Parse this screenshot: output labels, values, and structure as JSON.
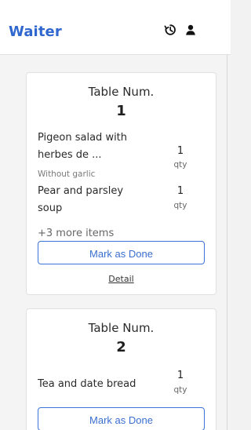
{
  "app": {
    "title": "Waiter",
    "accent_color": "#2f67cf"
  },
  "header": {
    "icons": [
      "history-icon",
      "user-icon"
    ]
  },
  "orders": [
    {
      "table_label": "Table Num.",
      "table_number": "1",
      "items": [
        {
          "name": "Pigeon salad with herbes de ...",
          "note": "Without garlic",
          "qty": "1",
          "qty_label": "qty"
        },
        {
          "name": "Pear and parsley soup",
          "note": "",
          "qty": "1",
          "qty_label": "qty"
        }
      ],
      "more_items": "+3 more items",
      "done_label": "Mark as Done",
      "detail_label": "Detail"
    },
    {
      "table_label": "Table Num.",
      "table_number": "2",
      "items": [
        {
          "name": "Tea and date bread",
          "note": "",
          "qty": "1",
          "qty_label": "qty"
        }
      ],
      "done_label": "Mark as Done"
    }
  ]
}
